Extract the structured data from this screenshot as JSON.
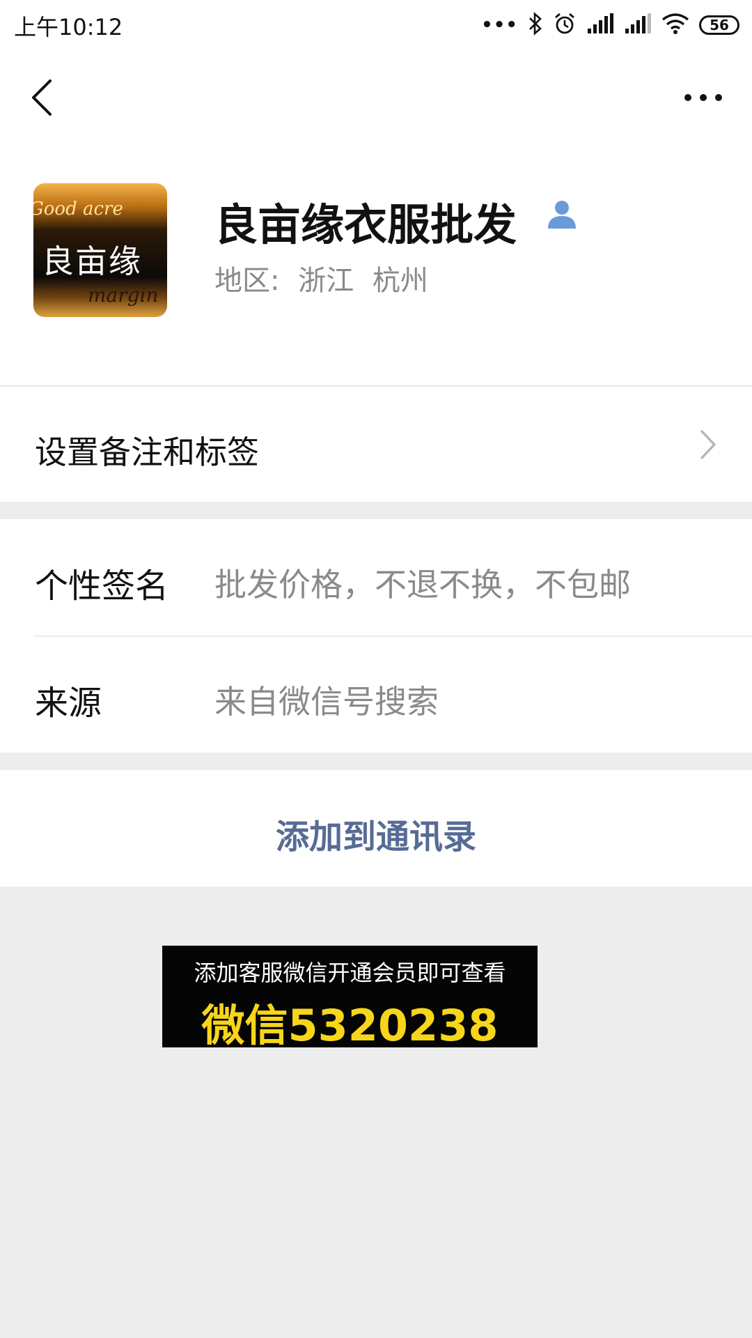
{
  "status_bar": {
    "time": "上午10:12",
    "more_dots": "•••",
    "battery": "56"
  },
  "nav": {
    "back_icon": "chevron-left-icon",
    "more_icon": "more-horizontal-icon"
  },
  "profile": {
    "avatar_text_top": "Good acre",
    "avatar_text_main": "良亩缘",
    "avatar_text_bottom": "margin",
    "name": "良亩缘衣服批发",
    "gender_icon": "person-icon",
    "region_label": "地区:",
    "region_province": "浙江",
    "region_city": "杭州"
  },
  "remark_row": {
    "label": "设置备注和标签"
  },
  "info": {
    "signature_key": "个性签名",
    "signature_value": "批发价格，不退不换，不包邮",
    "source_key": "来源",
    "source_value": "来自微信号搜索"
  },
  "actions": {
    "add_contact": "添加到通讯录"
  },
  "promo": {
    "line1": "添加客服微信开通会员即可查看",
    "line2": "微信5320238"
  },
  "colors": {
    "link": "#576b95",
    "promo_yellow": "#f7d51b",
    "background": "#ededed"
  }
}
